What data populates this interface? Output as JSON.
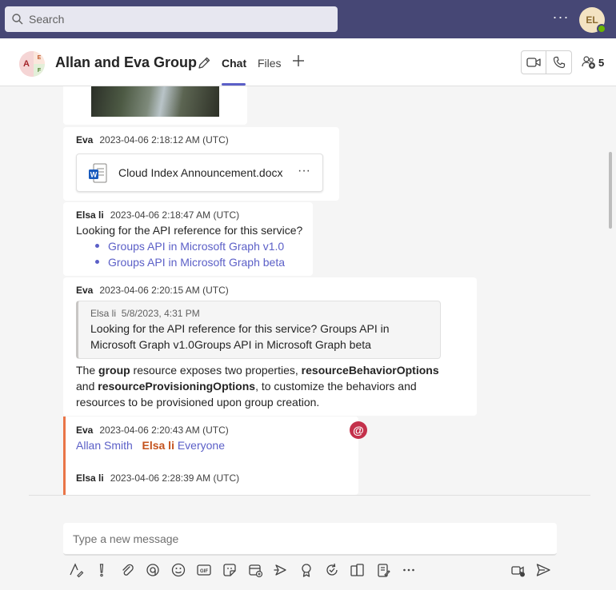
{
  "search": {
    "placeholder": "Search"
  },
  "topbar": {
    "more_label": "···",
    "user_initials": "EL"
  },
  "chat": {
    "avatar": {
      "a": "A",
      "e": "E",
      "f": "F"
    },
    "title": "Allan and Eva Group",
    "tabs": [
      {
        "label": "Chat"
      },
      {
        "label": "Files"
      }
    ],
    "participants_count": "5"
  },
  "messages": [
    {
      "author": "Eva",
      "time": "2023-04-06 2:18:12 AM (UTC)",
      "attachment": {
        "name": "Cloud Index Announcement.docx",
        "more": "···"
      }
    },
    {
      "author": "Elsa li",
      "time": "2023-04-06 2:18:47 AM (UTC)",
      "text": "Looking for the API reference for this service?",
      "links": [
        "Groups API in Microsoft Graph v1.0",
        "Groups API in Microsoft Graph beta"
      ]
    },
    {
      "author": "Eva",
      "time": "2023-04-06 2:20:15 AM (UTC)",
      "quote": {
        "author": "Elsa li",
        "time": "5/8/2023, 4:31 PM",
        "text": "Looking for the API reference for this service? Groups API in Microsoft Graph v1.0Groups API in Microsoft Graph beta"
      },
      "body": {
        "p1": "The ",
        "b1": "group",
        "p2": " resource exposes two properties, ",
        "b2": "resourceBehaviorOptions",
        "p3": " and ",
        "b3": "resourceProvisioningOptions",
        "p4": ", to customize the behaviors and resources to be provisioned upon group creation."
      }
    },
    {
      "author": "Eva",
      "time": "2023-04-06 2:20:43 AM (UTC)",
      "mentions": [
        "Allan Smith",
        "Elsa li",
        "Everyone"
      ],
      "badge": "@"
    },
    {
      "author": "Elsa li",
      "time": "2023-04-06 2:28:39 AM (UTC)"
    }
  ],
  "compose": {
    "placeholder": "Type a new message"
  },
  "colors": {
    "brand": "#464775",
    "accent": "#5b5fc7",
    "mention": "#e97548",
    "badge": "#c4314b"
  }
}
